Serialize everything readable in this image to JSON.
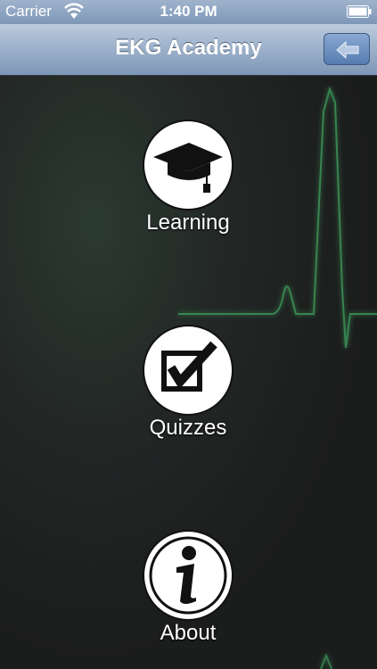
{
  "status_bar": {
    "carrier": "Carrier",
    "time": "1:40 PM"
  },
  "nav": {
    "title": "EKG Academy",
    "back_icon": "arrow-left-icon"
  },
  "menu": [
    {
      "label": "Learning",
      "icon": "graduation-cap-icon"
    },
    {
      "label": "Quizzes",
      "icon": "checkbox-icon"
    },
    {
      "label": "About",
      "icon": "info-icon"
    }
  ],
  "colors": {
    "ekg_trace": "#3a8f55",
    "nav_bar": "#9eb2cb",
    "background": "#1b1c1c"
  }
}
